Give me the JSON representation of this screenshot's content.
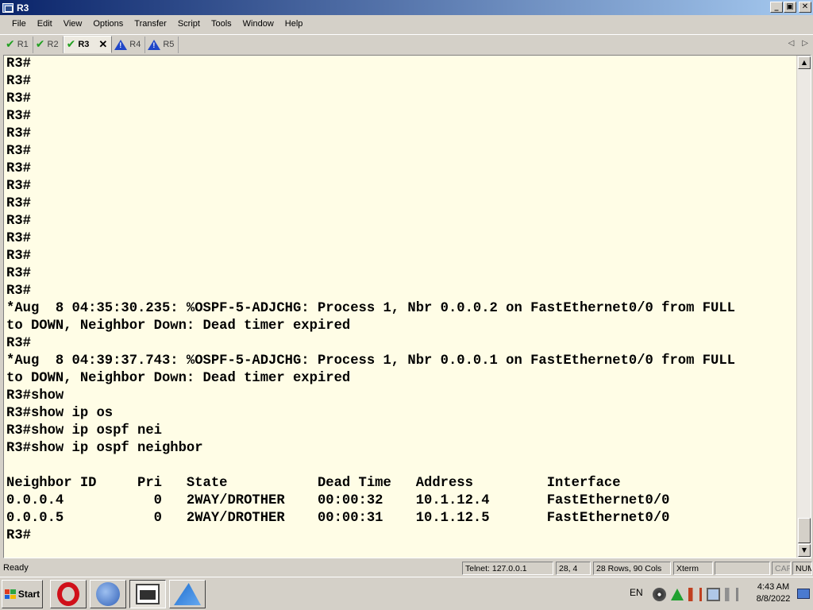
{
  "window": {
    "title": "R3",
    "controls": {
      "minimize": "_",
      "restore": "▣",
      "close": "✕"
    }
  },
  "menu": [
    "File",
    "Edit",
    "View",
    "Options",
    "Transfer",
    "Script",
    "Tools",
    "Window",
    "Help"
  ],
  "tabs": [
    {
      "label": "R1",
      "status": "connected",
      "active": false
    },
    {
      "label": "R2",
      "status": "connected",
      "active": false
    },
    {
      "label": "R3",
      "status": "connected",
      "active": true,
      "close": "✕"
    },
    {
      "label": "R4",
      "status": "warning",
      "active": false
    },
    {
      "label": "R5",
      "status": "warning",
      "active": false
    }
  ],
  "tab_nav": {
    "prev": "◁",
    "next": "▷"
  },
  "terminal": {
    "background": "#fffde6",
    "lines": [
      "R3#",
      "R3#",
      "R3#",
      "R3#",
      "R3#",
      "R3#",
      "R3#",
      "R3#",
      "R3#",
      "R3#",
      "R3#",
      "R3#",
      "R3#",
      "R3#",
      "*Aug  8 04:35:30.235: %OSPF-5-ADJCHG: Process 1, Nbr 0.0.0.2 on FastEthernet0/0 from FULL",
      "to DOWN, Neighbor Down: Dead timer expired",
      "R3#",
      "*Aug  8 04:39:37.743: %OSPF-5-ADJCHG: Process 1, Nbr 0.0.0.1 on FastEthernet0/0 from FULL",
      "to DOWN, Neighbor Down: Dead timer expired",
      "R3#show",
      "R3#show ip os",
      "R3#show ip ospf nei",
      "R3#show ip ospf neighbor",
      "",
      "Neighbor ID     Pri   State           Dead Time   Address         Interface",
      "0.0.0.4           0   2WAY/DROTHER    00:00:32    10.1.12.4       FastEthernet0/0",
      "0.0.0.5           0   2WAY/DROTHER    00:00:31    10.1.12.5       FastEthernet0/0",
      "R3#"
    ]
  },
  "scrollbar": {
    "up": "▲",
    "down": "▼"
  },
  "status": {
    "ready": "Ready",
    "connection": "Telnet: 127.0.0.1",
    "cursor": "28,  4",
    "size": "28 Rows, 90 Cols",
    "emulation": "Xterm",
    "empty": "",
    "cap": "CAP",
    "num": "NUM"
  },
  "taskbar": {
    "start_label": "Start",
    "apps": [
      "opera-icon",
      "ethereal-icon",
      "securecrt-icon",
      "wireshark-icon"
    ],
    "language": "EN",
    "clock_time": "4:43 AM",
    "clock_date": "8/8/2022"
  }
}
